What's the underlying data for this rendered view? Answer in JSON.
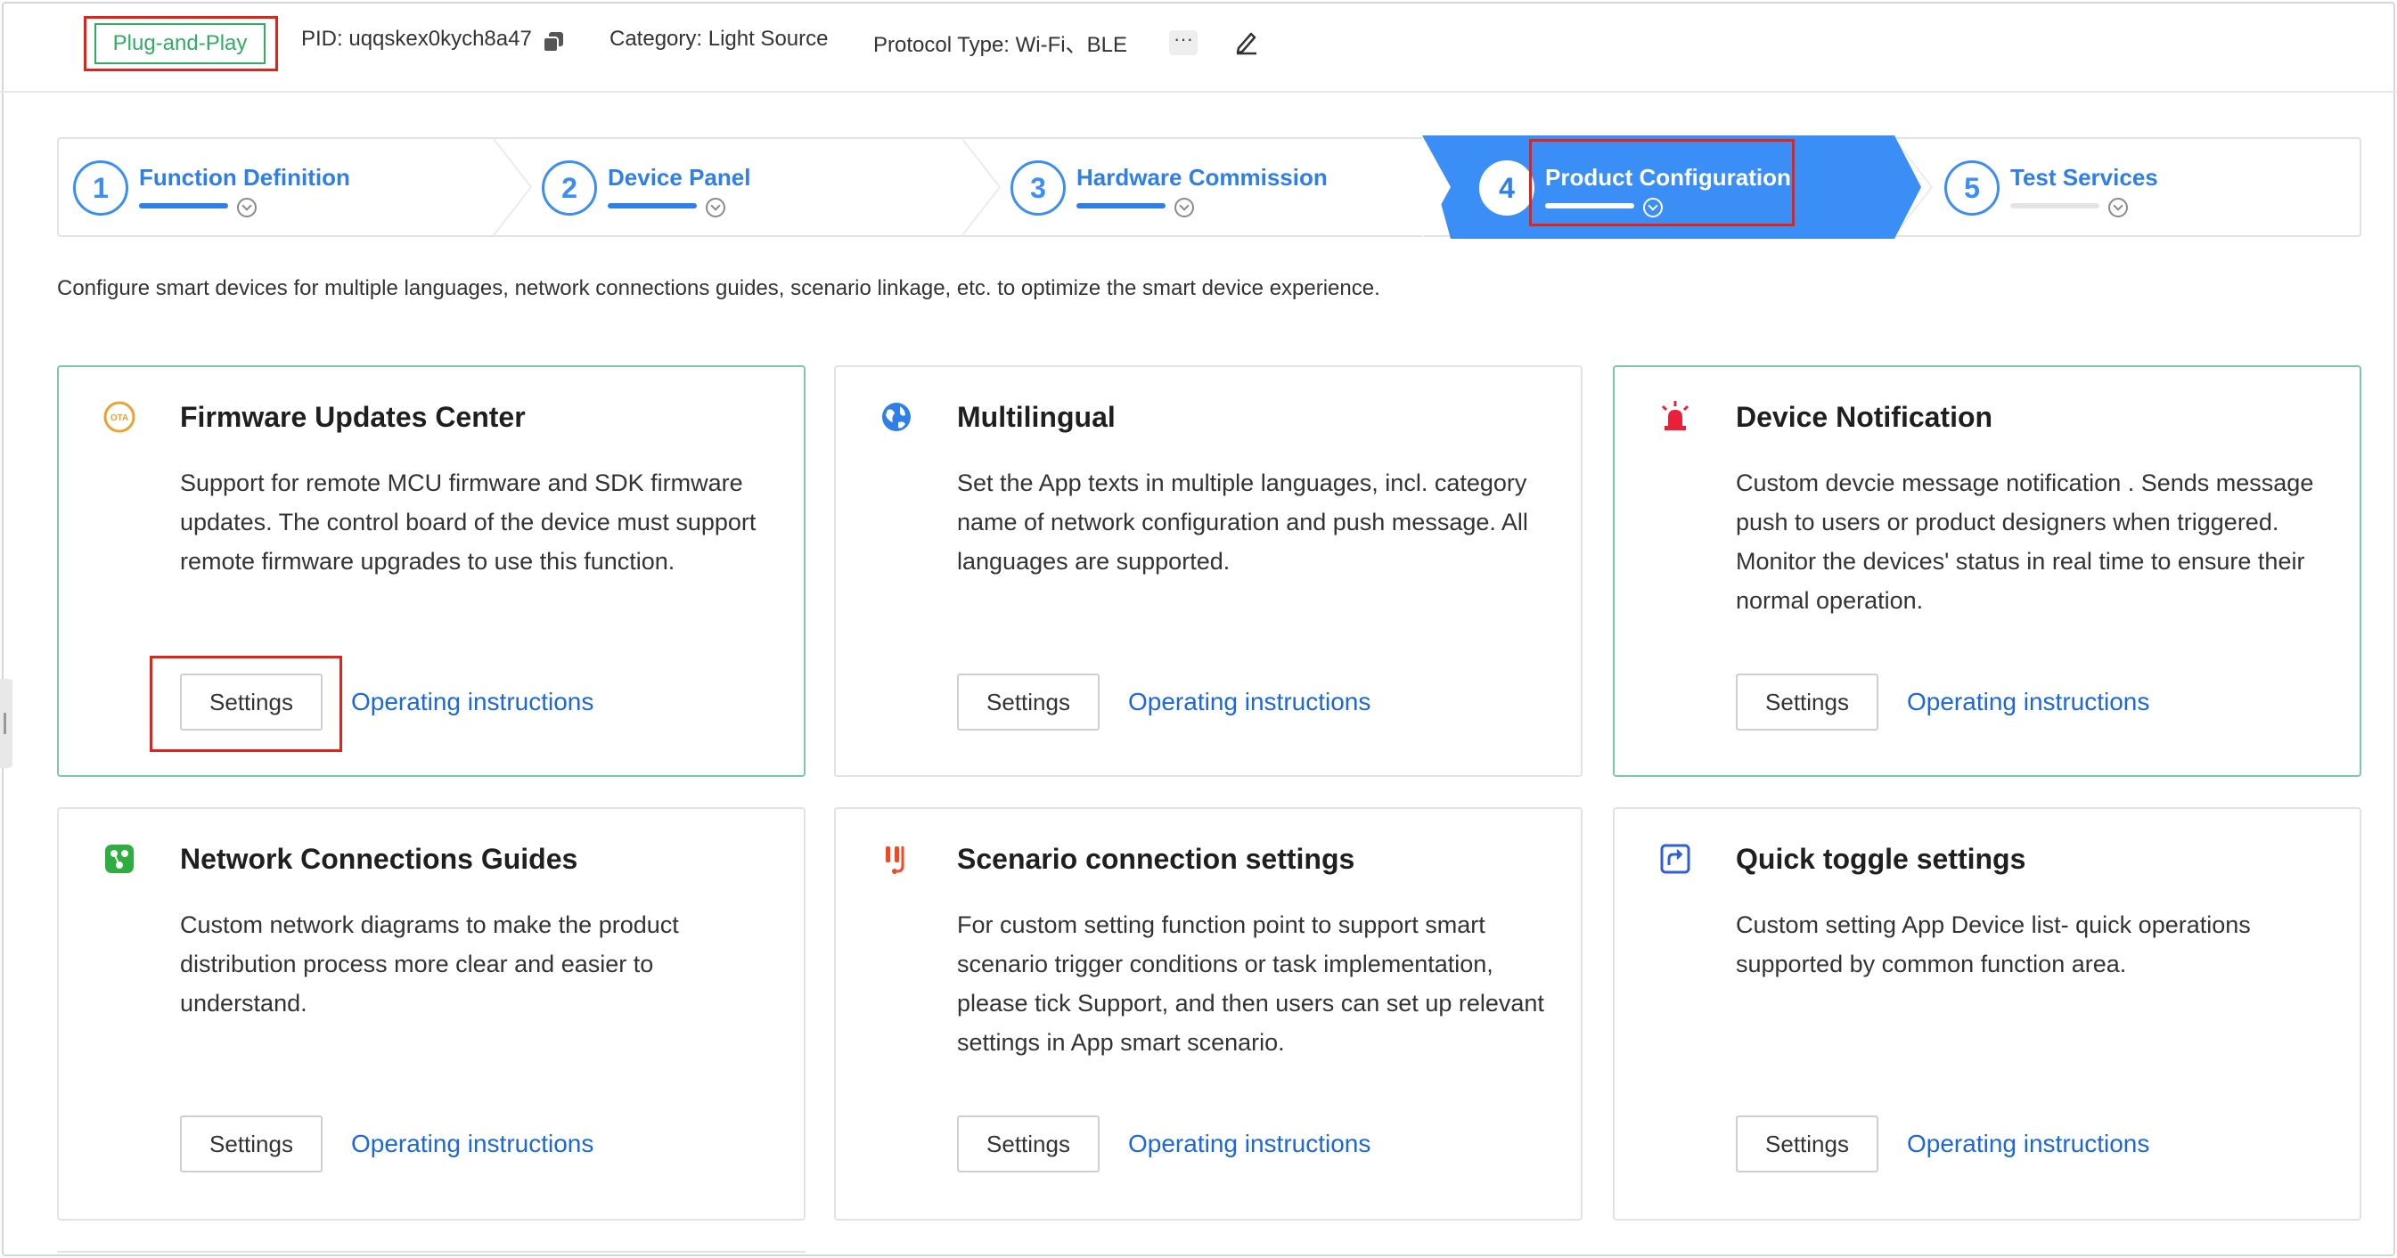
{
  "header": {
    "badge": "Plug-and-Play",
    "pid": "PID: uqqskex0kych8a47",
    "category": "Category: Light Source",
    "protocol": "Protocol Type: Wi-Fi、BLE",
    "more": "···"
  },
  "steps": [
    {
      "num": "1",
      "label": "Function Definition",
      "state": "done"
    },
    {
      "num": "2",
      "label": "Device Panel",
      "state": "done"
    },
    {
      "num": "3",
      "label": "Hardware Commission",
      "state": "done"
    },
    {
      "num": "4",
      "label": "Product Configuration",
      "state": "active"
    },
    {
      "num": "5",
      "label": "Test Services",
      "state": "pending"
    }
  ],
  "intro": "Configure smart devices for multiple languages, network connections guides, scenario linkage, etc. to optimize the smart device experience.",
  "cards": [
    {
      "title": "Firmware Updates Center",
      "desc": "Support for remote MCU firmware and SDK firmware updates. The control board of the device must support remote firmware upgrades to use this function.",
      "settings": "Settings",
      "link": "Operating instructions",
      "icon": "ota-icon",
      "icon_text": "OTA"
    },
    {
      "title": "Multilingual",
      "desc": "Set the App texts in multiple languages, incl. category name of network configuration and push message. All languages are supported.",
      "settings": "Settings",
      "link": "Operating instructions",
      "icon": "globe-icon"
    },
    {
      "title": "Device Notification",
      "desc": "Custom devcie message notification . Sends message push to users or product designers when triggered. Monitor the devices' status in real time to ensure their normal operation.",
      "settings": "Settings",
      "link": "Operating instructions",
      "icon": "alarm-light-icon"
    },
    {
      "title": "Network Connections Guides",
      "desc": "Custom network diagrams to make the product distribution process more clear and easier to understand.",
      "settings": "Settings",
      "link": "Operating instructions",
      "icon": "network-guide-icon"
    },
    {
      "title": "Scenario connection settings",
      "desc": "For custom setting function point to support smart scenario trigger conditions or task implementation, please tick Support, and then users can set up relevant settings in App smart scenario.",
      "settings": "Settings",
      "link": "Operating instructions",
      "icon": "scenario-icon"
    },
    {
      "title": "Quick toggle settings",
      "desc": "Custom setting App Device list- quick operations supported by common function area.",
      "settings": "Settings",
      "link": "Operating instructions",
      "icon": "shortcut-icon"
    }
  ],
  "colors": {
    "primary": "#2f7fe8",
    "active_step_bg": "#3a8ef6",
    "link": "#1a67e0",
    "success": "#2eae63",
    "highlight": "#e2231a"
  }
}
